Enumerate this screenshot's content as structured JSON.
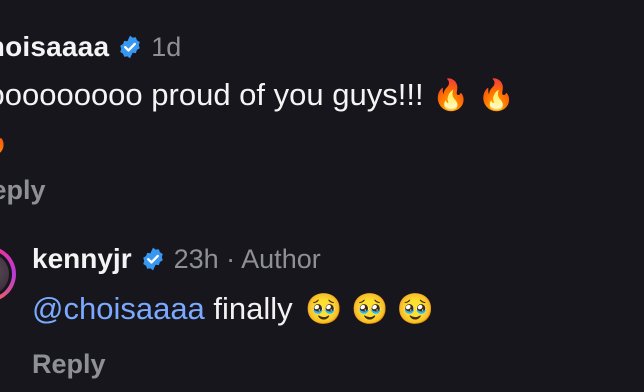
{
  "top_comment": {
    "username": "choisaaaa",
    "time": "1d",
    "text": "sooooooooo proud of you guys!!!",
    "emoji_line1": "🔥 🔥",
    "emoji_line2": "🔥",
    "reply_label": "Reply"
  },
  "reply_comment": {
    "username": "kennyjr",
    "meta": "23h · Author",
    "mention": "@choisaaaa",
    "text": " finally",
    "emojis": "🥹 🥹 🥹",
    "reply_label": "Reply"
  },
  "colors": {
    "background": "#16161c",
    "verified_badge": "#3897f0",
    "mention": "#7aa9ff",
    "muted_text": "#8f8f96"
  },
  "icons": [
    "verified-badge-icon",
    "fire-emoji",
    "pleading-face-emoji"
  ]
}
